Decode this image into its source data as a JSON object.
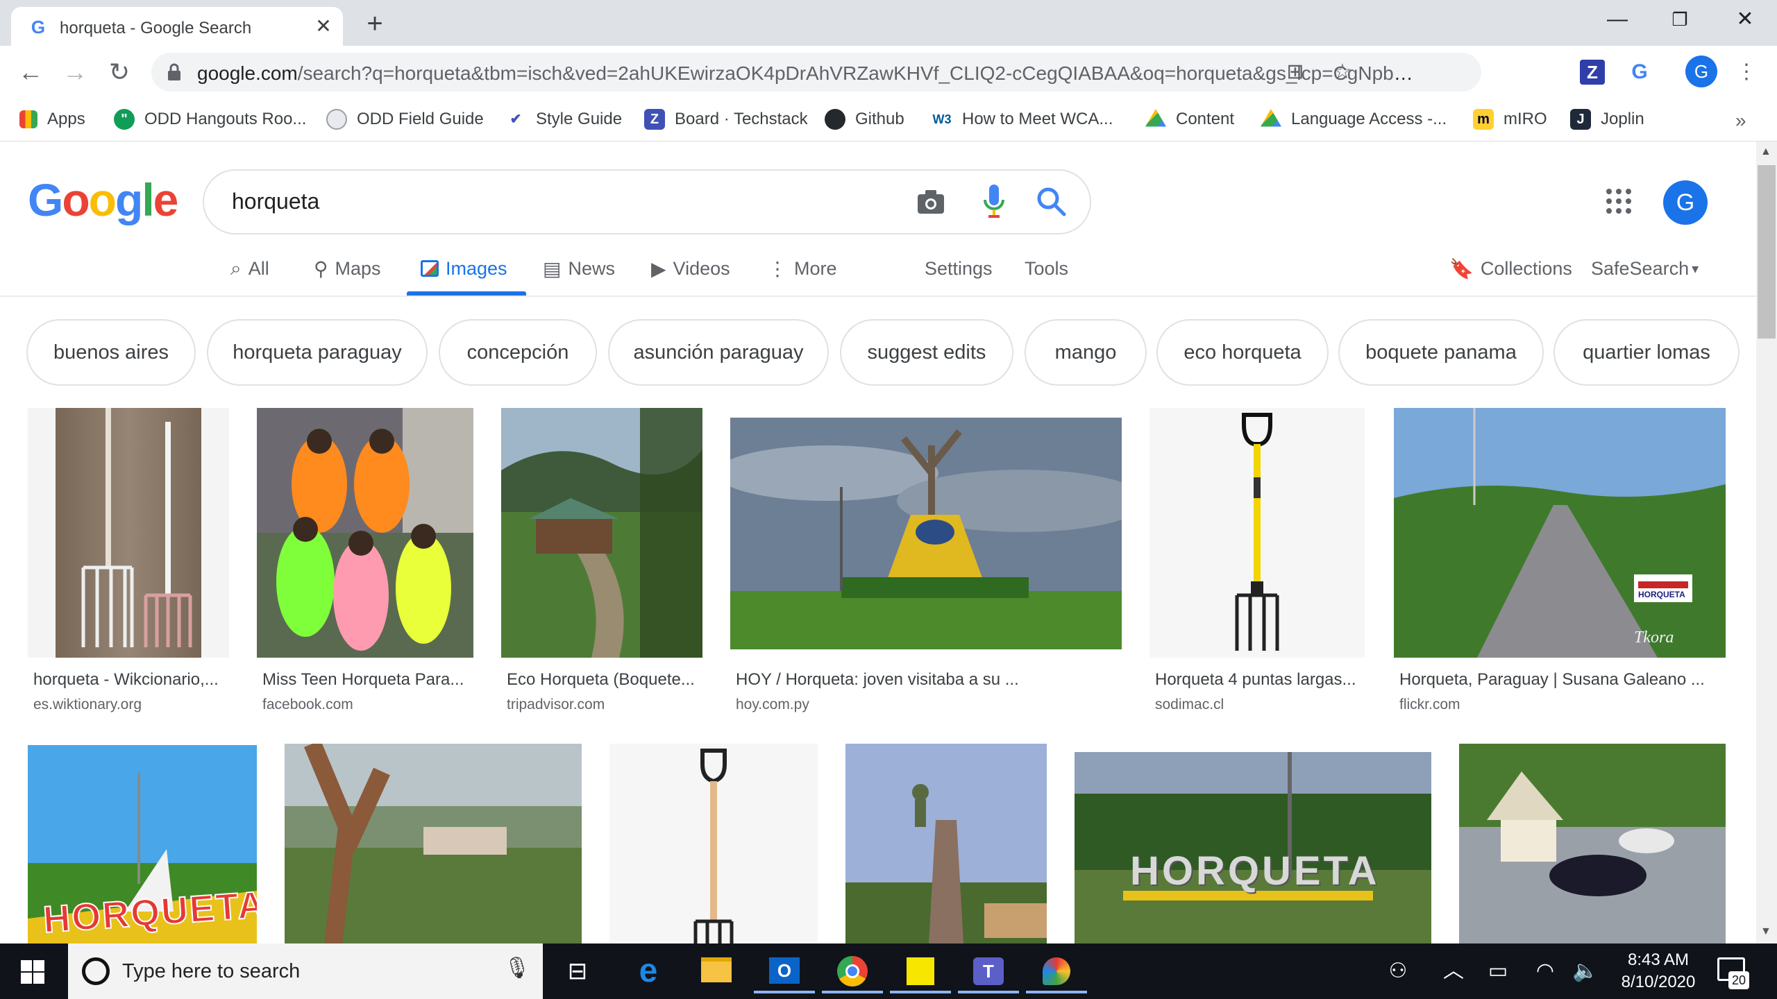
{
  "browser": {
    "tab_title": "horqueta - Google Search",
    "tab_favicon": "G",
    "new_tab_symbol": "+",
    "url_host": "google.com",
    "url_rest": "/search?q=horqueta&tbm=isch&ved=2ahUKEwirzaOK4pDrAhVRZawKHVf_CLIQ2-cCegQIABAA&oq=horqueta&gs_lcp=CgNpbWcQAz...",
    "profile_initial": "G"
  },
  "bookmarks": [
    {
      "label": "Apps",
      "icon": "apps-grid-icon"
    },
    {
      "label": "ODD Hangouts Roo...",
      "icon": "hangouts-icon"
    },
    {
      "label": "ODD Field Guide",
      "icon": "globe-icon"
    },
    {
      "label": "Style Guide",
      "icon": "style-icon"
    },
    {
      "label": "Board · Techstack",
      "icon": "zenhub-icon"
    },
    {
      "label": "Github",
      "icon": "github-icon"
    },
    {
      "label": "How to Meet WCA...",
      "icon": "w3c-icon"
    },
    {
      "label": "Content",
      "icon": "drive-icon"
    },
    {
      "label": "Language Access -...",
      "icon": "drive-icon"
    },
    {
      "label": "mIRO",
      "icon": "miro-icon"
    },
    {
      "label": "Joplin",
      "icon": "joplin-icon"
    }
  ],
  "search": {
    "query": "horqueta",
    "avatar_initial": "G"
  },
  "nav_tabs": [
    {
      "label": "All",
      "icon": "search-icon"
    },
    {
      "label": "Maps",
      "icon": "map-pin-icon"
    },
    {
      "label": "Images",
      "icon": "image-icon",
      "active": true
    },
    {
      "label": "News",
      "icon": "news-icon"
    },
    {
      "label": "Videos",
      "icon": "video-icon"
    },
    {
      "label": "More",
      "icon": "more-vert-icon"
    }
  ],
  "nav_tools": {
    "settings": "Settings",
    "tools": "Tools",
    "collections": "Collections",
    "safesearch": "SafeSearch"
  },
  "chips": [
    "buenos aires",
    "horqueta paraguay",
    "concepción",
    "asunción paraguay",
    "suggest edits",
    "mango",
    "eco horqueta",
    "boquete panama",
    "quartier lomas"
  ],
  "results": [
    {
      "title": "horqueta - Wikcionario,...",
      "source": "es.wiktionary.org"
    },
    {
      "title": "Miss Teen Horqueta Para...",
      "source": "facebook.com"
    },
    {
      "title": "Eco Horqueta (Boquete...",
      "source": "tripadvisor.com"
    },
    {
      "title": "HOY / Horqueta: joven visitaba a su ...",
      "source": "hoy.com.py"
    },
    {
      "title": "Horqueta 4 puntas largas...",
      "source": "sodimac.cl"
    },
    {
      "title": "Horqueta, Paraguay | Susana Galeano ...",
      "source": "flickr.com"
    }
  ],
  "result_image_text": {
    "sign_1": "HORQUETA",
    "sign_2": "HORQUETA",
    "watermark": "Tkora"
  },
  "taskbar": {
    "search_placeholder": "Type here to search",
    "time": "8:43 AM",
    "date": "8/10/2020",
    "notifications": "20"
  },
  "colors": {
    "accent": "#1a73e8",
    "tabstrip": "#dee1e6",
    "taskbar": "#10131a"
  }
}
